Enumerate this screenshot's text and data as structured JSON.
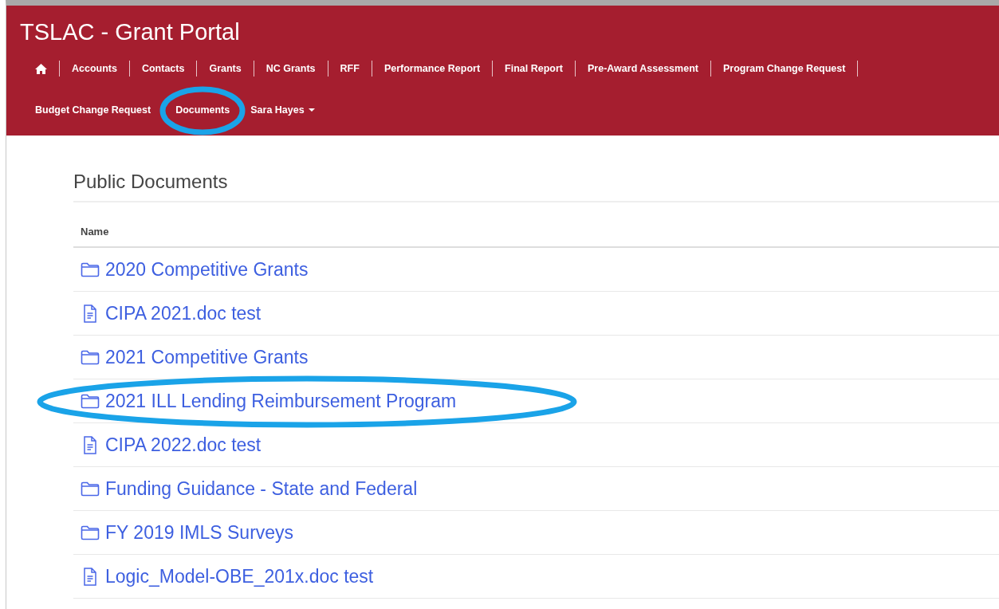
{
  "window": {
    "title": "TSLAC - Grant Portal"
  },
  "nav": [
    {
      "kind": "home"
    },
    {
      "kind": "link",
      "label": "Accounts"
    },
    {
      "kind": "link",
      "label": "Contacts"
    },
    {
      "kind": "link",
      "label": "Grants"
    },
    {
      "kind": "link",
      "label": "NC Grants"
    },
    {
      "kind": "link",
      "label": "RFF"
    },
    {
      "kind": "link",
      "label": "Performance Report"
    },
    {
      "kind": "link",
      "label": "Final Report"
    },
    {
      "kind": "link",
      "label": "Pre-Award Assessment"
    },
    {
      "kind": "link",
      "label": "Program Change Request"
    },
    {
      "kind": "link",
      "label": "Budget Change Request"
    },
    {
      "kind": "link",
      "label": "Documents"
    },
    {
      "kind": "dropdown",
      "label": "Sara Hayes"
    }
  ],
  "section": {
    "title": "Public Documents"
  },
  "table": {
    "columns": [
      "Name"
    ],
    "rows": [
      {
        "kind": "folder",
        "name": "2020 Competitive Grants"
      },
      {
        "kind": "file",
        "name": "CIPA 2021.doc test"
      },
      {
        "kind": "folder",
        "name": "2021 Competitive Grants"
      },
      {
        "kind": "folder",
        "name": "2021 ILL Lending Reimbursement Program"
      },
      {
        "kind": "file",
        "name": "CIPA 2022.doc test"
      },
      {
        "kind": "folder",
        "name": "Funding Guidance - State and Federal"
      },
      {
        "kind": "folder",
        "name": "FY 2019 IMLS Surveys"
      },
      {
        "kind": "file",
        "name": "Logic_Model-OBE_201x.doc test"
      }
    ]
  }
}
